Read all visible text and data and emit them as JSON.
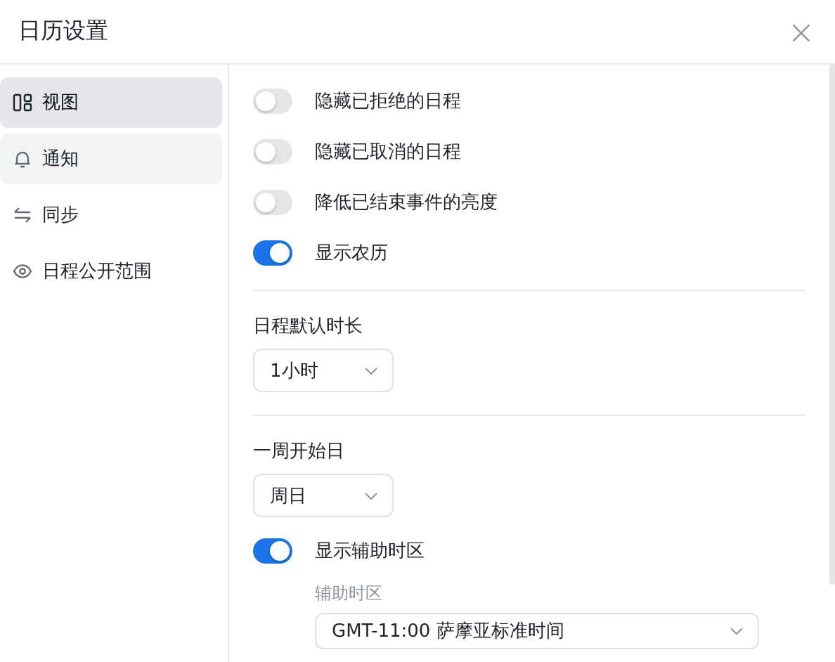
{
  "window": {
    "title": "日历设置",
    "close": "×"
  },
  "sidebar": {
    "items": [
      {
        "label": "视图",
        "selected": true,
        "hovered": false
      },
      {
        "label": "通知",
        "selected": false,
        "hovered": true
      },
      {
        "label": "同步",
        "selected": false,
        "hovered": false
      },
      {
        "label": "日程公开范围",
        "selected": false,
        "hovered": false
      }
    ]
  },
  "toggles": [
    {
      "label": "隐藏已拒绝的日程",
      "on": false
    },
    {
      "label": "隐藏已取消的日程",
      "on": false
    },
    {
      "label": "降低已结束事件的亮度",
      "on": false
    },
    {
      "label": "显示农历",
      "on": true
    }
  ],
  "default_duration": {
    "label": "日程默认时长",
    "value": "1小时"
  },
  "week_start": {
    "label": "一周开始日",
    "value": "周日"
  },
  "secondary_timezone": {
    "toggle_label": "显示辅助时区",
    "on": true,
    "label": "辅助时区",
    "value": "GMT-11:00 萨摩亚标准时间"
  }
}
